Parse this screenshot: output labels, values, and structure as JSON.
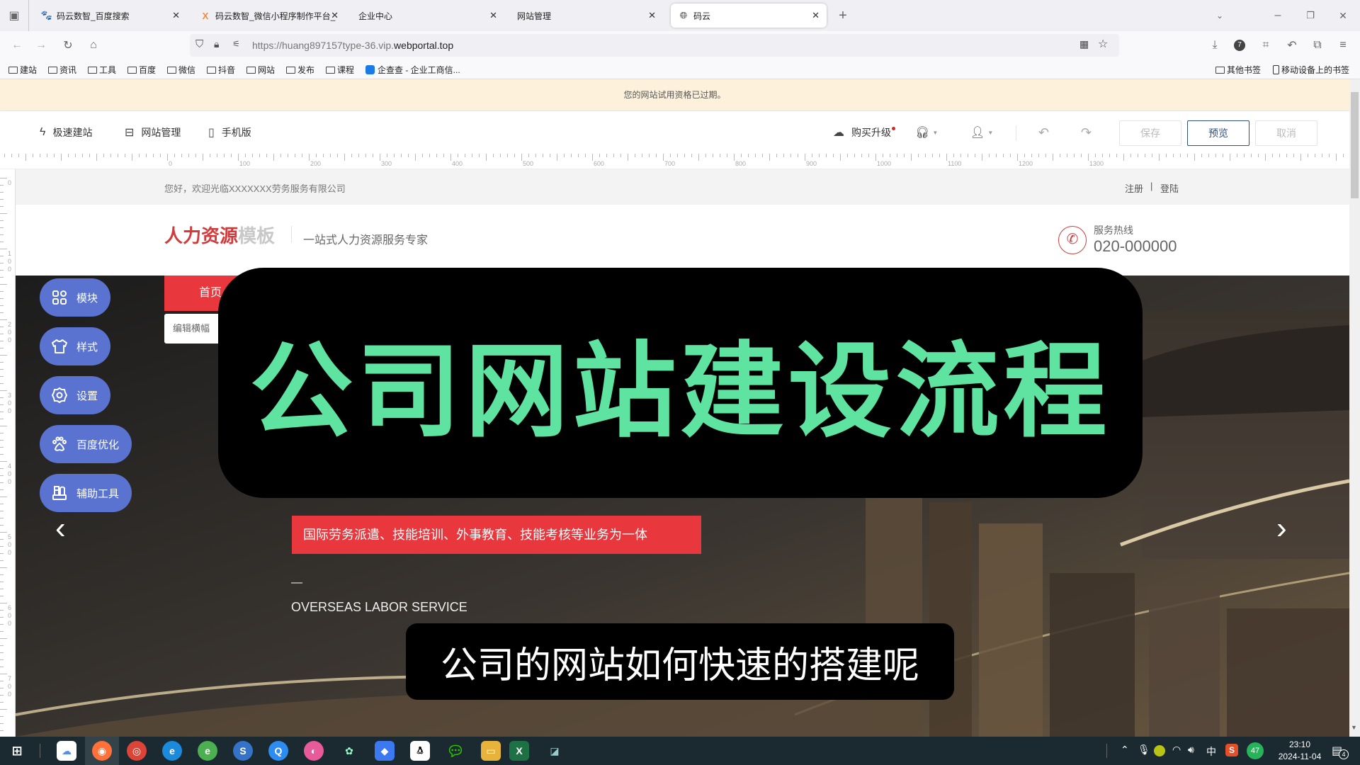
{
  "browser": {
    "tabs": [
      {
        "label": "码云数智_百度搜索",
        "icon": "baidu-paw-icon"
      },
      {
        "label": "码云数智_微信小程序制作平台_",
        "icon": "mayun-logo-icon"
      },
      {
        "label": "企业中心",
        "icon": ""
      },
      {
        "label": "网站管理",
        "icon": ""
      },
      {
        "label": "码云",
        "icon": "globe-icon",
        "active": true
      }
    ],
    "url_prefix": "https://huang897157type-36.vip.",
    "url_domain": "webportal.top",
    "bookmarks": [
      "建站",
      "资讯",
      "工具",
      "百度",
      "微信",
      "抖音",
      "网站",
      "发布",
      "课程"
    ],
    "bookmark_special": "企查查 - 企业工商信...",
    "bookmarks_right": [
      "其他书签",
      "移动设备上的书签"
    ],
    "extension_badge": "7"
  },
  "notice": "您的网站试用资格已过期。",
  "editor": {
    "tools_left": [
      {
        "label": "极速建站",
        "icon": "lightning-icon"
      },
      {
        "label": "网站管理",
        "icon": "browser-window-icon"
      },
      {
        "label": "手机版",
        "icon": "mobile-icon"
      }
    ],
    "upgrade_label": "购买升级",
    "save_label": "保存",
    "preview_label": "预览",
    "cancel_label": "取消",
    "ruler_h": [
      "0",
      "100",
      "200",
      "300",
      "400",
      "500",
      "600",
      "700",
      "800",
      "900",
      "1000",
      "1100",
      "1200",
      "1300"
    ],
    "ruler_v": [
      "0",
      "100",
      "200",
      "300",
      "400",
      "500",
      "600",
      "700"
    ]
  },
  "site": {
    "welcome": "您好，欢迎光临XXXXXXX劳务服务有限公司",
    "register": "注册",
    "login": "登陆",
    "logo_red": "人力资源",
    "logo_gray": "模板",
    "slogan": "一站式人力资源服务专家",
    "hotline_label": "服务热线",
    "hotline_number": "020-000000",
    "nav_home": "首页",
    "edit_banner": "编辑横幅",
    "banner_tagline": "国际劳务派遣、技能培训、外事教育、技能考核等业务为一体",
    "banner_dash": "—",
    "banner_en": "OVERSEAS LABOR SERVICE"
  },
  "side_panel": [
    {
      "label": "模块",
      "icon": "grid-icon"
    },
    {
      "label": "样式",
      "icon": "tshirt-icon"
    },
    {
      "label": "设置",
      "icon": "gear-icon"
    },
    {
      "label": "百度优化",
      "icon": "paw-icon"
    },
    {
      "label": "辅助工具",
      "icon": "toolbox-icon"
    }
  ],
  "overlay": {
    "title": "公司网站建设流程",
    "subtitle": "公司的网站如何快速的搭建呢"
  },
  "taskbar": {
    "time": "23:10",
    "date": "2024-11-04",
    "ime": "中",
    "badge": "47",
    "notifications": "4"
  },
  "colors": {
    "accent_red": "#e8373d",
    "pill_blue": "#5a73d1",
    "title_green": "#5fe3a1"
  }
}
